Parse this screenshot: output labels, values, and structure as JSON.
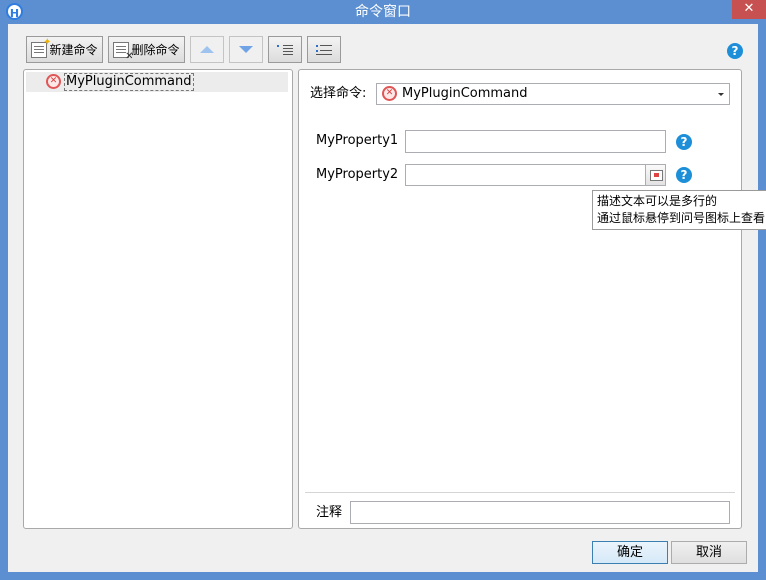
{
  "window": {
    "title": "命令窗口",
    "app_icon_letter": "H",
    "close_label": "✕"
  },
  "toolbar": {
    "new_label": "新建命令",
    "delete_label": "删除命令"
  },
  "tree": {
    "items": [
      {
        "label": "MyPluginCommand",
        "status_icon": "error-icon"
      }
    ]
  },
  "form": {
    "command_label": "选择命令:",
    "command_value": "MyPluginCommand",
    "properties": [
      {
        "label": "MyProperty1",
        "value": ""
      },
      {
        "label": "MyProperty2",
        "value": ""
      }
    ],
    "note_label": "注释",
    "note_value": ""
  },
  "tooltip": {
    "line1": "描述文本可以是多行的",
    "line2": "通过鼠标悬停到问号图标上查看"
  },
  "buttons": {
    "ok": "确定",
    "cancel": "取消"
  },
  "help_glyph": "?",
  "colors": {
    "title_bar": "#5b8fd1",
    "close_button": "#c75050",
    "help_icon": "#1d8fd8",
    "error_icon": "#e05555"
  }
}
